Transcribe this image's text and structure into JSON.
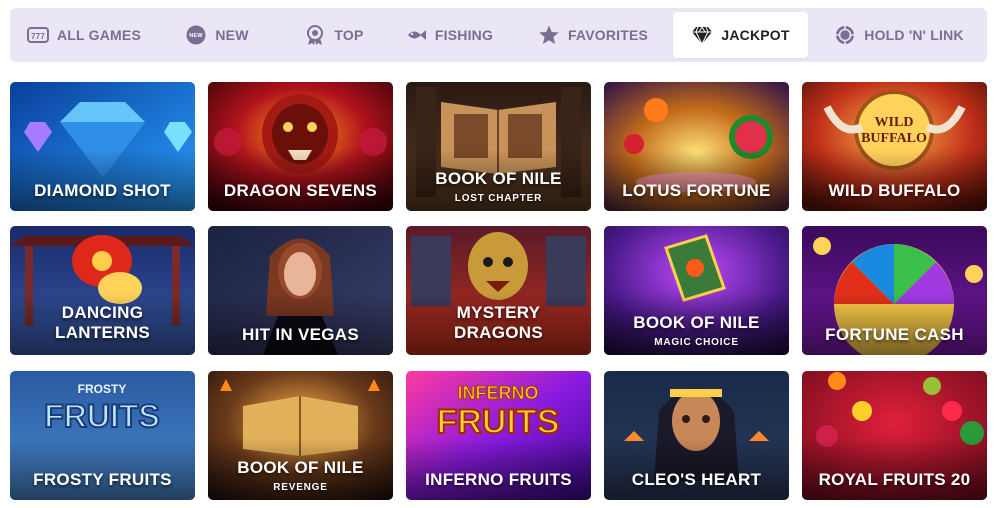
{
  "tabs": [
    {
      "label": "ALL GAMES",
      "icon": "slot-777-icon",
      "active": false
    },
    {
      "label": "NEW",
      "icon": "new-badge-icon",
      "active": false
    },
    {
      "label": "TOP",
      "icon": "award-badge-icon",
      "active": false
    },
    {
      "label": "FISHING",
      "icon": "fish-icon",
      "active": false
    },
    {
      "label": "FAVORITES",
      "icon": "star-icon",
      "active": false
    },
    {
      "label": "JACKPOT",
      "icon": "diamond-icon",
      "active": true
    },
    {
      "label": "HOLD 'N' LINK",
      "icon": "coin-icon",
      "active": false
    }
  ],
  "new_icon_text": "NEW",
  "games": [
    {
      "title": "DIAMOND SHOT",
      "subtitle": ""
    },
    {
      "title": "DRAGON SEVENS",
      "subtitle": ""
    },
    {
      "title": "BOOK OF NILE",
      "subtitle": "LOST CHAPTER"
    },
    {
      "title": "LOTUS FORTUNE",
      "subtitle": ""
    },
    {
      "title": "WILD BUFFALO",
      "subtitle": ""
    },
    {
      "title": "DANCING LANTERNS",
      "subtitle": ""
    },
    {
      "title": "HIT IN VEGAS",
      "subtitle": ""
    },
    {
      "title": "MYSTERY DRAGONS",
      "subtitle": ""
    },
    {
      "title": "BOOK OF NILE",
      "subtitle": "MAGIC CHOICE"
    },
    {
      "title": "FORTUNE CASH",
      "subtitle": ""
    },
    {
      "title": "FROSTY FRUITS",
      "subtitle": ""
    },
    {
      "title": "BOOK OF NILE",
      "subtitle": "REVENGE"
    },
    {
      "title": "INFERNO FRUITS",
      "subtitle": ""
    },
    {
      "title": "CLEO'S HEART",
      "subtitle": ""
    },
    {
      "title": "ROYAL FRUITS 20",
      "subtitle": ""
    }
  ],
  "logo_text": {
    "wild_buffalo": "WILD BUFFALO",
    "frosty_fruits": "FROSTY FRUITS",
    "inferno_fruits": "INFERNO FRUITS"
  },
  "colors": {
    "tabbar_bg": "#ebe6f5",
    "tab_text": "#7a6f93",
    "tab_active_text": "#222222"
  }
}
